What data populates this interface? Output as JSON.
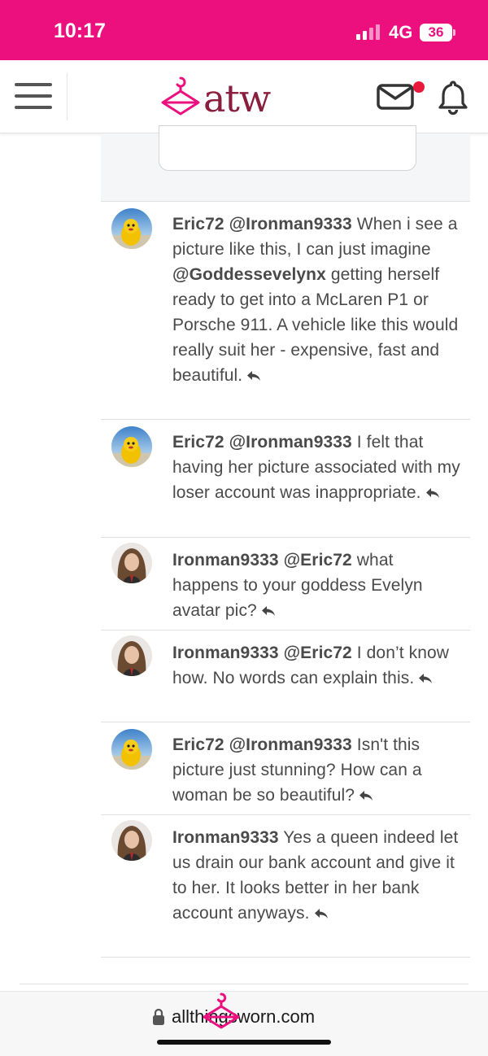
{
  "status_bar": {
    "time": "10:17",
    "network": "4G",
    "battery": "36"
  },
  "header": {
    "brand": "atw",
    "menu_icon": "hamburger-menu-icon",
    "messages_icon": "envelope-icon",
    "notifications_icon": "bell-icon",
    "has_unread_messages": true
  },
  "colors": {
    "brand_pink": "#ec0f7e",
    "brand_maroon": "#8a1e3d",
    "text": "#4a4a4a",
    "unread_dot": "#e8193c"
  },
  "comments": [
    {
      "author": "Eric72",
      "mention": "@Ironman9333",
      "text_before": "When i see a picture like this, I can just imagine ",
      "inline_mention": "@Goddessevelynx",
      "text_after": " getting herself ready to get into a McLaren P1 or Porsche 911. A vehicle like this would really suit her - expensive, fast and beautiful.",
      "avatar": "yellow-mascot-avatar"
    },
    {
      "author": "Eric72",
      "mention": "@Ironman9333",
      "text": "I felt that having her picture associated with my loser account was inappropriate.",
      "avatar": "yellow-mascot-avatar"
    },
    {
      "author": "Ironman9333",
      "mention": "@Eric72",
      "text": "what happens to your goddess Evelyn avatar pic?",
      "avatar": "woman-portrait-avatar"
    },
    {
      "author": "Ironman9333",
      "mention": "@Eric72",
      "text": "I don’t know how. No words can explain this.",
      "avatar": "woman-portrait-avatar"
    },
    {
      "author": "Eric72",
      "mention": "@Ironman9333",
      "text": "Isn't this picture just stunning? How can a woman be so beautiful?",
      "avatar": "yellow-mascot-avatar"
    },
    {
      "author": "Ironman9333",
      "mention": "",
      "text": "Yes a queen indeed let us drain our bank account and give it to her. It looks better in her bank account anyways.",
      "avatar": "woman-portrait-avatar"
    }
  ],
  "browser": {
    "url": "allthingsworn.com"
  }
}
